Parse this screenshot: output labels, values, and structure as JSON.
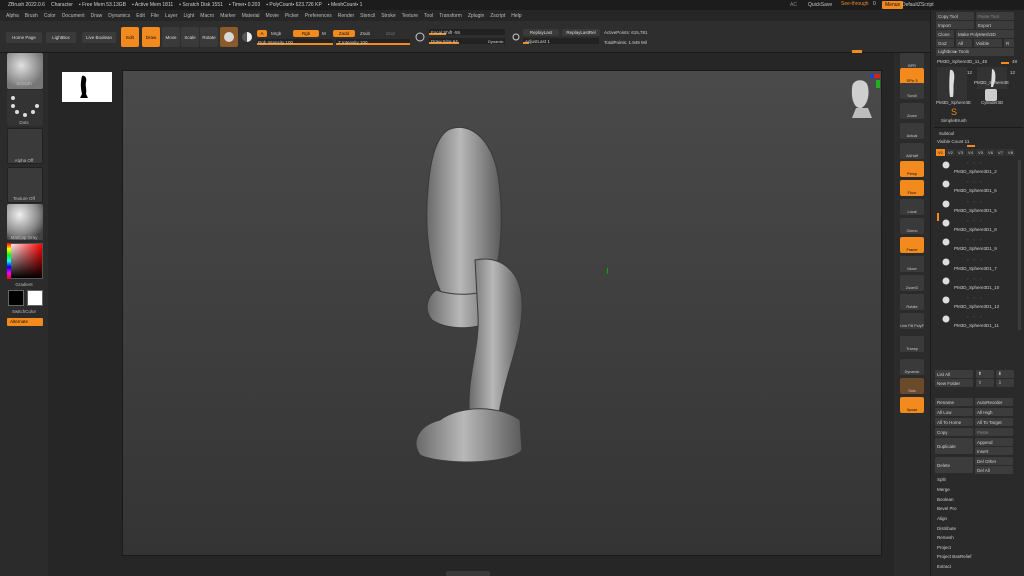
{
  "titlebar": {
    "app": "ZBrush 2022.0.6",
    "doc": "Character",
    "stats": [
      "▪ Free Mem 53.13GB",
      "▪ Active Mem 1811",
      "▪ Scratch Disk 1551",
      "▪ Timer▪ 0.203",
      "▪ PolyCount▪ 623.726 KP",
      "▪ MeshCount▪ 1"
    ],
    "ac": "AC",
    "quicksave": "QuickSave",
    "seethrough": "See-through",
    "seethrough_val": "0",
    "menus": "Menus",
    "script": "DefaultZScript"
  },
  "menubar": [
    "Alpha",
    "Brush",
    "Color",
    "Document",
    "Draw",
    "Dynamics",
    "Edit",
    "File",
    "Layer",
    "Light",
    "Macro",
    "Marker",
    "Material",
    "Movie",
    "Picker",
    "Preferences",
    "Render",
    "Stencil",
    "Stroke",
    "Texture",
    "Tool",
    "Transform",
    "Zplugin",
    "Zscript",
    "Help"
  ],
  "toolbar": {
    "home": "Home Page",
    "lightbox": "LightBox",
    "live_boolean": "Live Boolean",
    "edit": "Edit",
    "draw": "Draw",
    "move": "Move",
    "scale": "Scale",
    "rotate": "Rotate",
    "a": "A",
    "mrgb": "Mrgb",
    "rgb": "Rgb",
    "m": "M",
    "rgb_intensity": "Rgb Intensity 100",
    "zadd": "Zadd",
    "zsub": "Zsub",
    "zcut": "Zcut",
    "z_intensity": "Z Intensity 100",
    "focal_shift": "Focal Shift -55",
    "draw_size": "Draw Size 64",
    "dynamic": "Dynamic",
    "replay_last": "ReplayLast",
    "replay_last_rel": "ReplayLastRel",
    "adjust_last": "AdjustLast 1",
    "active_points": "ActivePoints: 615,781",
    "total_points": "TotalPoints: 1.949 Mil"
  },
  "left_shelf": {
    "brush": "Smooth",
    "stroke": "Dots",
    "alpha": "Alpha Off",
    "texture": "Texture Off",
    "material": "MatCap Gray",
    "gradient": "Gradient",
    "switch_color": "SwitchColor",
    "alternate": "Alternate"
  },
  "right_shelf": [
    "BPR",
    "SPix 3",
    "Scroll",
    "Zoom",
    "Actual",
    "AAHalf",
    "Persp",
    "Floor",
    "Local",
    "Gizmo",
    "Frame",
    "Move",
    "ZoomD",
    "Rotate",
    "Line Fill PolyF",
    "Transp",
    "Dynamic",
    "Solo",
    "Xpose"
  ],
  "right_panel": {
    "copy_tool": "Copy Tool",
    "paste_tool": "Paste Tool",
    "import": "Import",
    "export": "Export",
    "clone": "Clone",
    "make_polymesh": "Make PolyMesh3D",
    "goz": "GoZ",
    "all": "All",
    "visible": "Visible",
    "r": "R",
    "lightbox_tools": "Lightbox▸ Tools",
    "current_tool": "PM3D_Sphere3D_11_48",
    "current_tool_val": "48",
    "thumb1_count": "12",
    "thumb2_count": "12",
    "thumb2_name": "PM3D_Sphere3E",
    "thumb1_name": "PM3D_Sphere3E",
    "cylinder": "Cylinder3D",
    "simplebrush": "SimpleBrush",
    "subtool_header": "Subtool",
    "visible_count": "Visible Count 11",
    "v_tabs": [
      "V1",
      "V2",
      "V3",
      "V4",
      "V5",
      "V6",
      "V7",
      "V8"
    ],
    "subtools": [
      "PM3D_Sphere3D1_2",
      "PM3D_Sphere3D1_6",
      "PM3D_Sphere3D1_5",
      "PM3D_Sphere3D1_8",
      "PM3D_Sphere3D1_9",
      "PM3D_Sphere3D1_7",
      "PM3D_Sphere3D1_10",
      "PM3D_Sphere3D1_12",
      "PM3D_Sphere3D1_11"
    ],
    "list_all": "List All",
    "new_folder": "New Folder",
    "rename": "Rename",
    "autoreorder": "AutoReorder",
    "all_low": "All Low",
    "all_high": "All High",
    "all_to_home": "All To Home",
    "all_to_target": "All To Target",
    "copy": "Copy",
    "paste": "Paste",
    "duplicate": "Duplicate",
    "append": "Append",
    "insert": "Insert",
    "delete": "Delete",
    "del_other": "Del Other",
    "del_all": "Del All",
    "split": "Split",
    "merge": "Merge",
    "boolean": "Boolean",
    "bevel_pro": "Bevel Pro",
    "align": "Align",
    "distribute": "Distribute",
    "remesh": "Remesh",
    "project": "Project",
    "project_bas": "Project BasRelief",
    "extract": "Extract"
  },
  "colors": {
    "accent": "#f28a1d",
    "bg": "#2a2a2a",
    "viewport": "#444444"
  }
}
